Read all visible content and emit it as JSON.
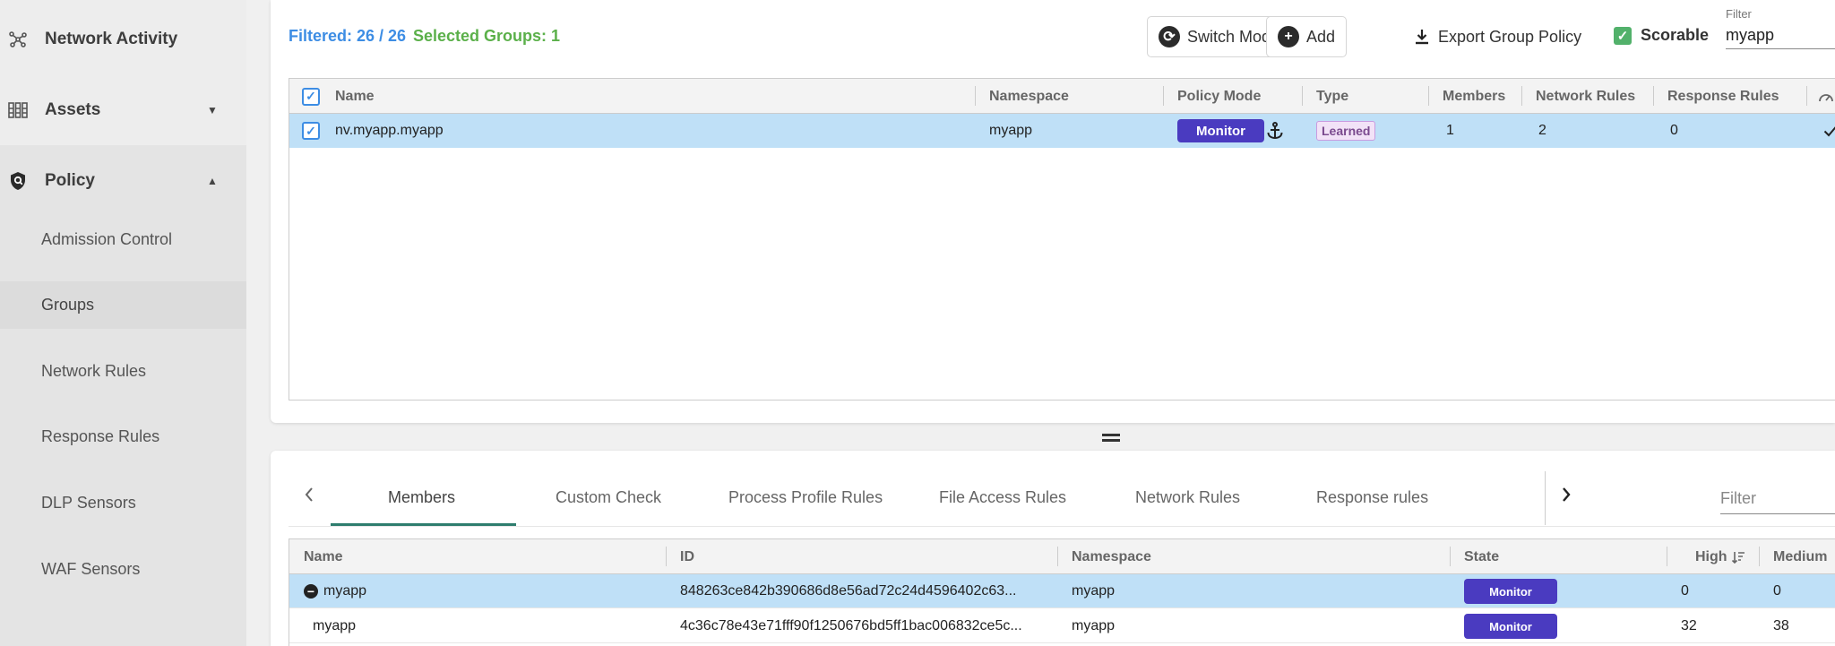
{
  "sidebar": {
    "items": [
      {
        "label": "Network Activity",
        "icon": "network-activity-icon"
      },
      {
        "label": "Assets",
        "icon": "assets-icon"
      },
      {
        "label": "Policy",
        "icon": "policy-shield-icon"
      }
    ],
    "policy_sub": [
      {
        "label": "Admission Control"
      },
      {
        "label": "Groups"
      },
      {
        "label": "Network Rules"
      },
      {
        "label": "Response Rules"
      },
      {
        "label": "DLP Sensors"
      },
      {
        "label": "WAF Sensors"
      }
    ]
  },
  "top": {
    "filtered": "Filtered: 26 / 26",
    "selected_groups": "Selected Groups:  1",
    "switch_mode": "Switch Mode",
    "add": "Add",
    "export": "Export Group Policy",
    "scorable": "Scorable",
    "filter_label": "Filter",
    "filter_value": "myapp",
    "grid": {
      "headers": [
        "Name",
        "Namespace",
        "Policy Mode",
        "Type",
        "Members",
        "Network Rules",
        "Response Rules"
      ],
      "row": {
        "name": "nv.myapp.myapp",
        "namespace": "myapp",
        "policy_mode": "Monitor",
        "type": "Learned",
        "members": "1",
        "network_rules": "2",
        "response_rules": "0"
      }
    }
  },
  "bottom": {
    "tabs": [
      "Members",
      "Custom Check",
      "Process Profile Rules",
      "File Access Rules",
      "Network Rules",
      "Response rules"
    ],
    "filter_placeholder": "Filter",
    "grid": {
      "headers": [
        "Name",
        "ID",
        "Namespace",
        "State",
        "High",
        "Medium"
      ],
      "rows": [
        {
          "name": "myapp",
          "id": "848263ce842b390686d8e56ad72c24d4596402c63...",
          "namespace": "myapp",
          "state": "Monitor",
          "high": "0",
          "medium": "0"
        },
        {
          "name": "myapp",
          "id": "4c36c78e43e71fff90f1250676bd5ff1bac006832ce5c...",
          "namespace": "myapp",
          "state": "Monitor",
          "high": "32",
          "medium": "38"
        }
      ]
    }
  },
  "colors": {
    "accent_blue": "#3d8de4",
    "accent_green": "#5bb04a",
    "mode_purple": "#4a3bc0",
    "selected_row": "#bfe0f7",
    "tab_underline": "#2e7d6e"
  }
}
